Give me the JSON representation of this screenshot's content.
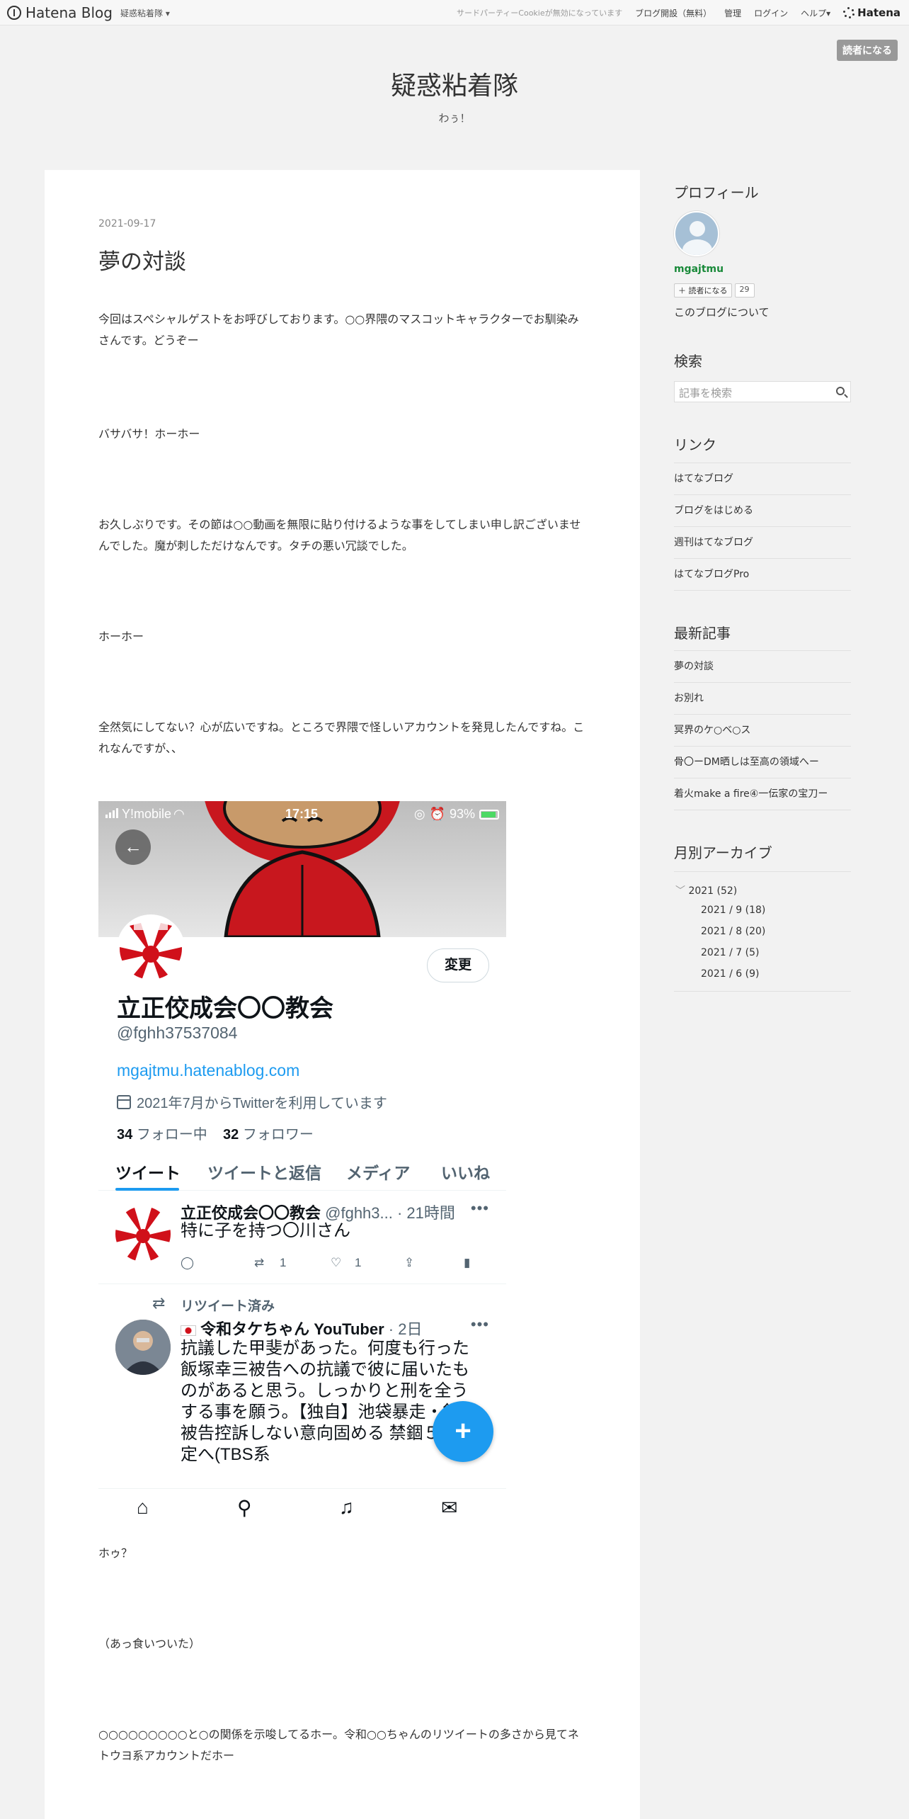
{
  "topbar": {
    "logo": "Hatena Blog",
    "blog_menu": "疑惑粘着隊",
    "cookie_notice": "サードパーティーCookieが無効になっています",
    "open_blog": "ブログ開設（無料）",
    "manage": "管理",
    "login": "ログイン",
    "help": "ヘルプ",
    "hatena": "Hatena",
    "subscribe": "読者になる"
  },
  "header": {
    "title": "疑惑粘着隊",
    "description": "わぅ！"
  },
  "entry": {
    "date": "2021-09-17",
    "title": "夢の対談",
    "paragraphs": [
      "今回はスペシャルゲストをお呼びしております。○○界隈のマスコットキャラクターでお馴染み さんです。どうぞー",
      "バサバサ！ホーホー",
      "お久しぶりです。その節は○○動画を無限に貼り付けるような事をしてしまい申し訳ございませんでした。魔が刺しただけなんです。タチの悪い冗談でした。",
      "ホーホー",
      "全然気にしてない？心が広いですね。ところで界隈で怪しいアカウントを発見したんですね。これなんですが、、",
      "ホゥ？",
      "（あっ食いついた）",
      "○○○○○○○○○と○の関係を示唆してるホー。令和○○ちゃんのリツイートの多さから見てネトウヨ系アカウントだホー"
    ]
  },
  "twitter": {
    "carrier": "Y!mobile",
    "time": "17:15",
    "battery": "93%",
    "edit": "変更",
    "name": "立正佼成会〇〇教会",
    "handle": "@fghh37537084",
    "url": "mgajtmu.hatenablog.com",
    "joined": "2021年7月からTwitterを利用しています",
    "following_count": "34",
    "following_label": "フォロー中",
    "followers_count": "32",
    "followers_label": "フォロワー",
    "tabs": [
      "ツイート",
      "ツイートと返信",
      "メディア",
      "いいね"
    ],
    "tweet1": {
      "name": "立正佼成会〇〇教会",
      "meta": "@fghh3... · 21時間",
      "text": "特に子を持つ〇川さん",
      "retweets": "1",
      "likes": "1"
    },
    "tweet2": {
      "retweeted": "リツイート済み",
      "name": "令和タケちゃん YouTuber",
      "meta": "· 2日",
      "text": "抗議した甲斐があった。何度も行った飯塚幸三被告への抗議で彼に届いたものがあると思う。しっかりと刑を全うする事を願う。【独自】池袋暴走・飯塚被告控訴しない意向固める 禁錮５年確定へ(TBS系"
    }
  },
  "sidebar": {
    "profile_heading": "プロフィール",
    "profile_name": "mgajtmu",
    "reader_button": "読者になる",
    "reader_count": "29",
    "about": "このブログについて",
    "search_heading": "検索",
    "search_placeholder": "記事を検索",
    "links_heading": "リンク",
    "links": [
      "はてなブログ",
      "ブログをはじめる",
      "週刊はてなブログ",
      "はてなブログPro"
    ],
    "recent_heading": "最新記事",
    "recent": [
      "夢の対談",
      "お別れ",
      "冥界のケ○ベ○ス",
      "骨〇ーDM晒しは至高の領域へー",
      "着火make a fire④一伝家の宝刀ー"
    ],
    "archive_heading": "月別アーカイブ",
    "archive_year": "2021 (52)",
    "archive_months": [
      "2021 / 9 (18)",
      "2021 / 8 (20)",
      "2021 / 7 (5)",
      "2021 / 6 (9)"
    ]
  }
}
